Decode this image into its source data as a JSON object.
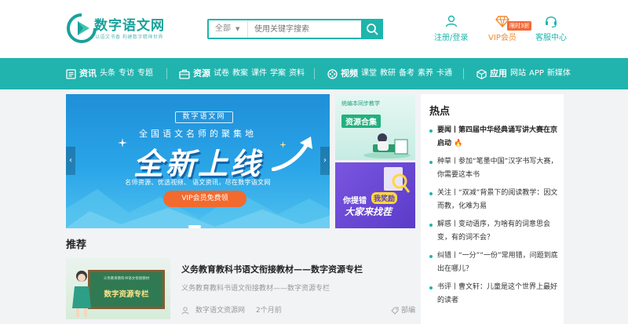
{
  "header": {
    "logo_title": "数字语文网",
    "logo_subtitle": "以语文书香 构建数字精神世界",
    "search": {
      "scope": "全部",
      "placeholder": "使用关键字搜索"
    },
    "links": {
      "register_login": "注册/登录",
      "vip": "VIP会员",
      "vip_badge": "限时3折",
      "help": "客服中心"
    }
  },
  "nav": {
    "groups": [
      {
        "title": "资讯",
        "items": [
          "头条",
          "专访",
          "专题"
        ]
      },
      {
        "title": "资源",
        "items": [
          "试卷",
          "教案",
          "课件",
          "学案",
          "资料"
        ]
      },
      {
        "title": "视频",
        "items": [
          "课堂",
          "教研",
          "备考",
          "素养",
          "卡通"
        ]
      },
      {
        "title": "应用",
        "items": [
          "网站",
          "APP",
          "新媒体"
        ]
      }
    ]
  },
  "banner": {
    "tag": "数字语文网",
    "line1": "全国语文名师的聚集地",
    "headline": "全新上线",
    "features": "名师资源、优选视频、 语文资讯，尽在数字语文网",
    "cta": "VIP会员免费领"
  },
  "side_cards": [
    {
      "sub": "统编本同步教学",
      "title": "资源合集"
    },
    {
      "line1": "你提错",
      "highlight": "我奖励",
      "line2": "大家来找茬"
    }
  ],
  "recommend": {
    "title": "推荐",
    "article": {
      "thumb_line1": "义务教育教科书语文衔接教材",
      "thumb_line2": "数字资源专栏",
      "title": "义务教育教科书语文衔接教材——数字资源专栏",
      "desc": "义务教育教科书语文衔接教材——数字资源专栏",
      "author": "数字语文资源网",
      "time": "2个月前",
      "tag": "部编"
    }
  },
  "hot": {
    "title": "热点",
    "items": [
      {
        "text": "要闻丨第四届中华经典诵写讲大赛在京启动",
        "fire": "🔥"
      },
      {
        "text": "种草丨参加“笔墨中国”汉字书写大赛，你需要这本书"
      },
      {
        "text": "关注丨“双减”背景下的阅读教学：因文而教，化难为易"
      },
      {
        "text": "解惑丨变动语序，为啥有的词意思会变，有的词不会？"
      },
      {
        "text": "纠错丨“一分”“一份”常用错，问题到底出在哪儿？"
      },
      {
        "text": "书评丨曹文轩：儿童是这个世界上最好的读者"
      }
    ]
  },
  "colors": {
    "brand": "#1db5ad",
    "nav_bg": "#21b4ae",
    "accent": "#f26b3a"
  }
}
